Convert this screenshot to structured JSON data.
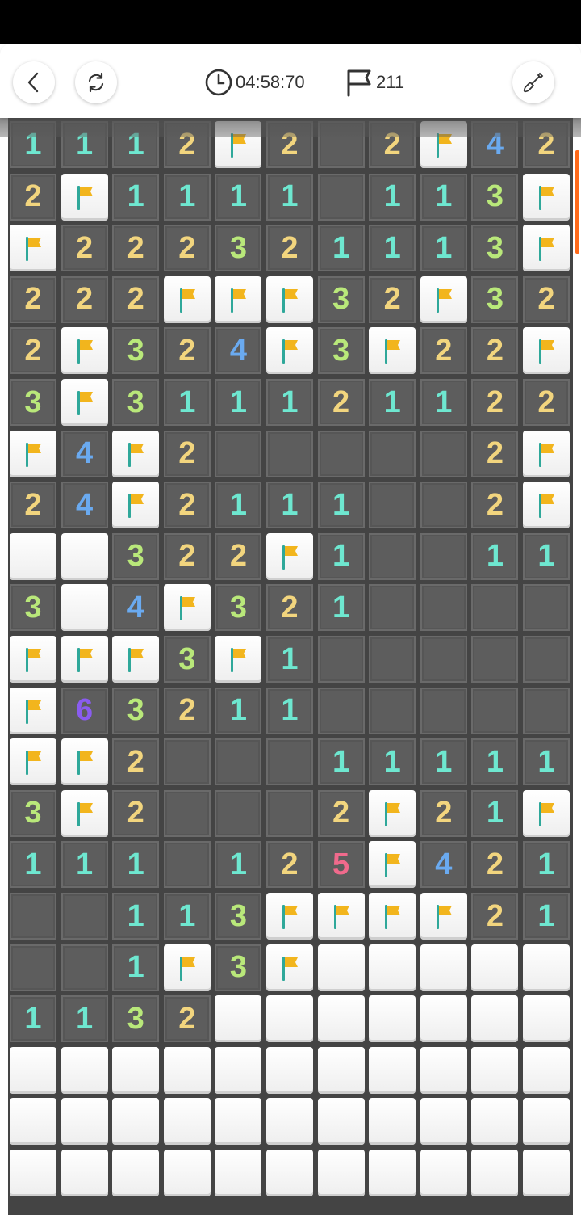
{
  "toolbar": {
    "timer": "04:58:70",
    "flags_remaining": "211",
    "icons": [
      "back-chevron-icon",
      "refresh-icon",
      "clock-icon",
      "flag-outline-icon",
      "shovel-icon"
    ]
  },
  "colors": {
    "1": "#6ee7d0",
    "2": "#f2d57e",
    "3": "#b9e87a",
    "4": "#6aaaf0",
    "5": "#f06a8c",
    "6": "#8a5cf0",
    "open": "#5d5d5d",
    "flag": "#f2b51d"
  },
  "board": {
    "columns": 11,
    "legend": ". = revealed empty, 1-8 = revealed number, F = flag, # = unrevealed",
    "rows": [
      "1112F2.2F42",
      "2F1111.113F",
      "F222321113F",
      "222FFF32F32",
      "2F324F3F22F",
      "3F311121122",
      "F4F2.....2F",
      "24F2111..2F",
      "##322F1..11",
      "3#4F321....",
      "FFF3F1.....",
      "F63211.....",
      "FF2...11111",
      "3F2...2F21F",
      "111.125F421",
      "..113FFFF21",
      "..1F3F#####",
      "1132#######",
      "###########",
      "###########",
      "###########"
    ]
  }
}
